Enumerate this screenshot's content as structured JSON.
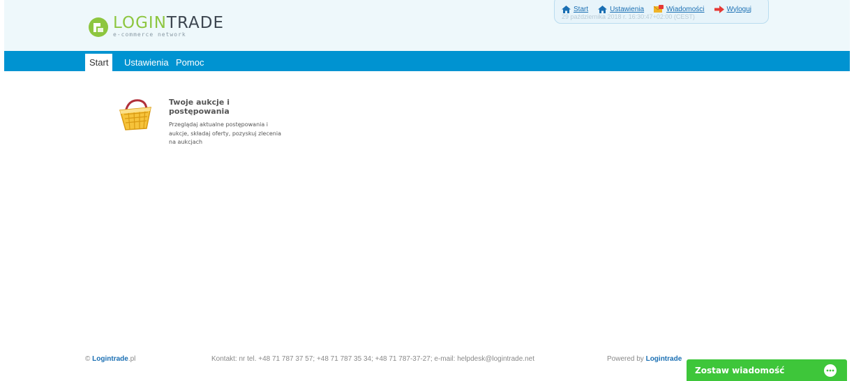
{
  "header": {
    "logo": {
      "word_part1": "LOGIN",
      "word_part2": "TRADE",
      "tagline": "e-commerce network"
    },
    "user_links": [
      {
        "label": "Start",
        "icon": "home-icon"
      },
      {
        "label": "Ustawienia",
        "icon": "home-icon"
      },
      {
        "label": "Wiadomości",
        "icon": "envelope-icon"
      },
      {
        "label": "Wyloguj",
        "icon": "arrow-right-icon"
      }
    ],
    "datetime": "29 października 2018 r. 16:30:47+02:00 (CEST)"
  },
  "nav": {
    "items": [
      {
        "label": "Start",
        "active": true
      },
      {
        "label": "Ustawienia",
        "active": false
      },
      {
        "label": "Pomoc",
        "active": false
      }
    ]
  },
  "main": {
    "tile": {
      "icon": "shopping-basket-icon",
      "title": "Twoje aukcje i postępowania",
      "description": "Przeglądaj aktualne postępowania i aukcje, składaj oferty, pozyskuj zlecenia na aukcjach"
    }
  },
  "footer": {
    "copyright_symbol": "©",
    "brand": "Logintrade",
    "brand_suffix": ".pl",
    "contact": "Kontakt: nr tel. +48 71 787 37 57; +48 71 787 35 34; +48 71 787-37-27; e-mail: helpdesk@logintrade.net",
    "powered_by": "Powered by",
    "powered_brand": "Logintrade"
  },
  "chat": {
    "label": "Zostaw wiadomość",
    "icon": "chat-bubble-icon"
  },
  "colors": {
    "nav_blue": "#0093d1",
    "link_blue": "#1a6fb3",
    "logo_green": "#8dc63f",
    "chat_green": "#3ec63a",
    "header_bg": "#eef8fb"
  }
}
